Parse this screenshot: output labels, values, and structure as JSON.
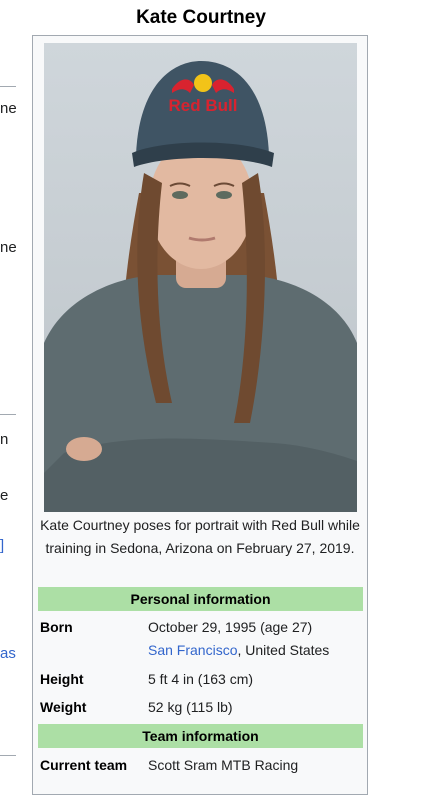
{
  "infobox": {
    "title": "Kate Courtney",
    "image_caption": "Kate Courtney poses for portrait with Red Bull while training in Sedona, Arizona on February 27, 2019.",
    "cap_logo_text": "Red Bull",
    "sections": {
      "personal_header": "Personal information",
      "team_header": "Team information"
    },
    "born": {
      "label": "Born",
      "date": "October 29, 1995 (age 27)",
      "place_link": "San Francisco",
      "place_rest": ", United States"
    },
    "height": {
      "label": "Height",
      "value": "5 ft 4 in (163 cm)"
    },
    "weight": {
      "label": "Weight",
      "value": "52 kg (115 lb)"
    },
    "current_team": {
      "label": "Current team",
      "value": "Scott Sram MTB Racing"
    }
  },
  "left_fragments": {
    "f1": "ne",
    "f2": "ne",
    "f3": "n",
    "f4": "e",
    "f5": "]",
    "f6": "as"
  },
  "colors": {
    "section_header_bg": "#acdfa5",
    "link": "#3366cc",
    "infobox_bg": "#f8f9fa"
  }
}
